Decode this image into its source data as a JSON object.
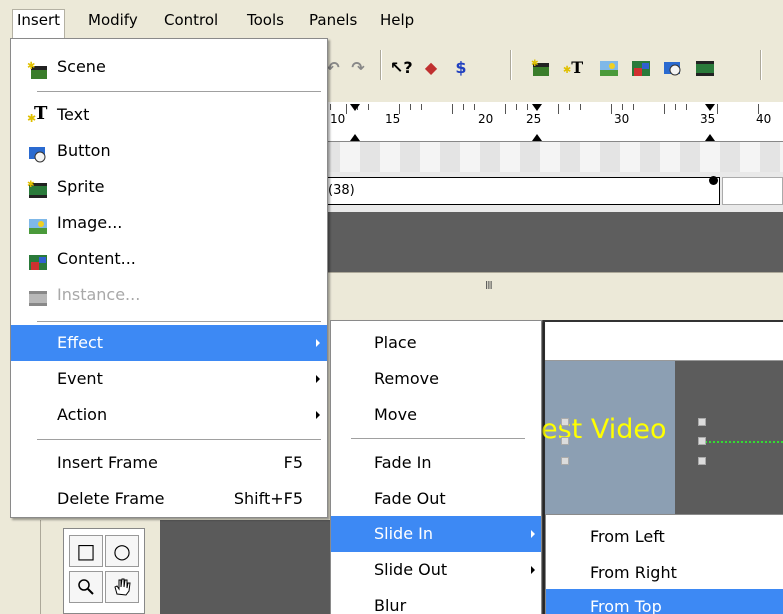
{
  "menubar": {
    "items": [
      {
        "label": "Insert"
      },
      {
        "label": "Modify"
      },
      {
        "label": "Control"
      },
      {
        "label": "Tools"
      },
      {
        "label": "Panels"
      },
      {
        "label": "Help"
      }
    ]
  },
  "toolbar": {
    "help_glyph": "?",
    "dollar_glyph": "$",
    "text_tool_glyph": "T"
  },
  "timeline": {
    "ruler_numbers": [
      "10",
      "15",
      "20",
      "25",
      "30",
      "35",
      "40"
    ],
    "layer_label": "(38)",
    "scroll_grip": "III"
  },
  "stage": {
    "text": "est Video"
  },
  "insert_menu": {
    "items": [
      {
        "label": "Scene",
        "icon": "scene-icon"
      },
      {
        "label": "Text",
        "icon": "text-icon"
      },
      {
        "label": "Button",
        "icon": "button-icon"
      },
      {
        "label": "Sprite",
        "icon": "sprite-icon"
      },
      {
        "label": "Image...",
        "icon": "image-icon"
      },
      {
        "label": "Content...",
        "icon": "content-icon"
      },
      {
        "label": "Instance...",
        "icon": "instance-icon",
        "disabled": true
      },
      {
        "label": "Effect",
        "submenu": true,
        "selected": true
      },
      {
        "label": "Event",
        "submenu": true
      },
      {
        "label": "Action",
        "submenu": true
      },
      {
        "label": "Insert Frame",
        "shortcut": "F5"
      },
      {
        "label": "Delete Frame",
        "shortcut": "Shift+F5"
      }
    ]
  },
  "effect_menu": {
    "items": [
      {
        "label": "Place"
      },
      {
        "label": "Remove"
      },
      {
        "label": "Move"
      },
      {
        "label": "Fade In"
      },
      {
        "label": "Fade Out"
      },
      {
        "label": "Slide In",
        "submenu": true,
        "selected": true
      },
      {
        "label": "Slide Out",
        "submenu": true
      },
      {
        "label": "Blur"
      }
    ]
  },
  "slidein_menu": {
    "items": [
      {
        "label": "From Left"
      },
      {
        "label": "From Right"
      },
      {
        "label": "From Top",
        "selected": true
      }
    ]
  },
  "colors": {
    "selection": "#3d89f4",
    "menu_bg": "#ffffff",
    "chrome": "#ece9d8",
    "stage_text": "#ffff00"
  }
}
